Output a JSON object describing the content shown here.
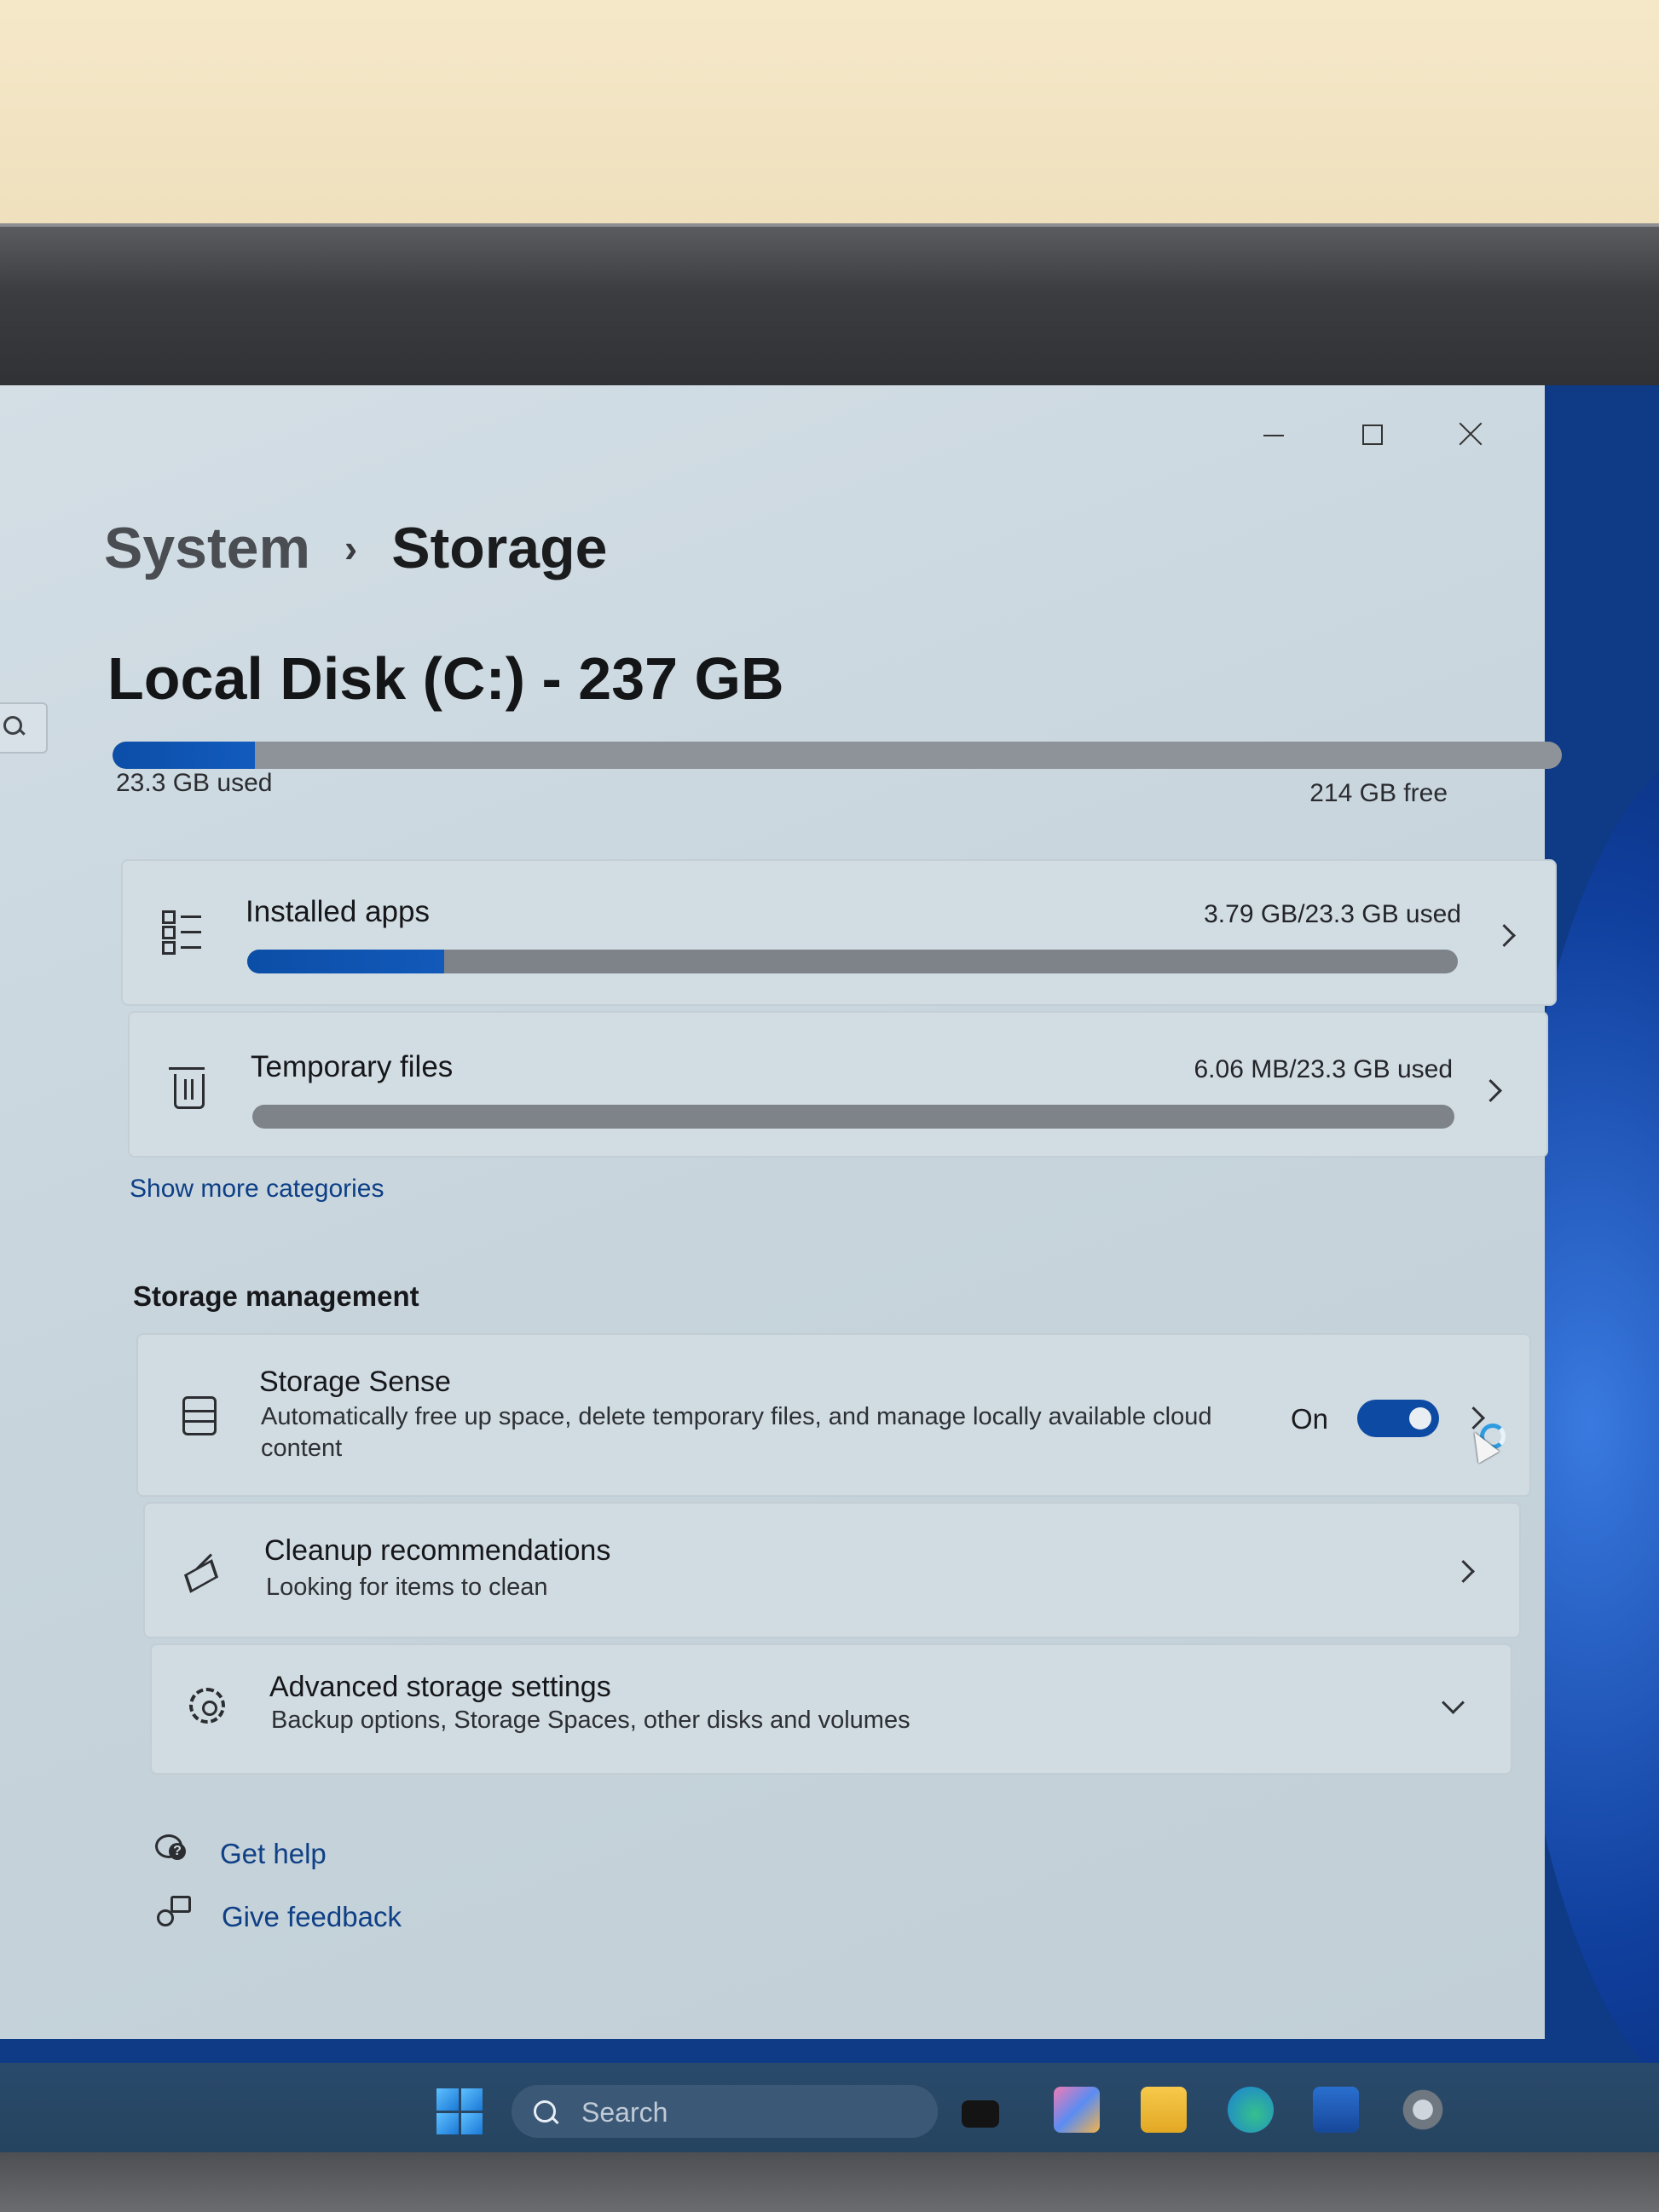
{
  "window": {
    "controls": {
      "minimize": "minimize",
      "maximize": "maximize",
      "close": "close"
    }
  },
  "breadcrumb": {
    "parent": "System",
    "separator": "›",
    "current": "Storage"
  },
  "disk": {
    "title": "Local Disk (C:) - 237 GB",
    "used_label": "23.3 GB used",
    "free_label": "214 GB free",
    "used_fraction": 0.098
  },
  "categories": [
    {
      "label": "Installed apps",
      "usage": "3.79 GB/23.3 GB used",
      "fraction": 0.163,
      "icon": "list-icon"
    },
    {
      "label": "Temporary files",
      "usage": "6.06 MB/23.3 GB used",
      "fraction": 0.0,
      "icon": "trash-icon"
    }
  ],
  "show_more": "Show more categories",
  "storage_management": {
    "heading": "Storage management",
    "items": [
      {
        "title": "Storage Sense",
        "desc": "Automatically free up space, delete temporary files, and manage locally available cloud content",
        "toggle_label": "On",
        "toggle_on": true,
        "icon": "drive-icon"
      },
      {
        "title": "Cleanup recommendations",
        "desc": "Looking for items to clean",
        "icon": "broom-icon"
      },
      {
        "title": "Advanced storage settings",
        "desc": "Backup options, Storage Spaces, other disks and volumes",
        "icon": "gear-icon"
      }
    ]
  },
  "help": {
    "get_help": "Get help",
    "give_feedback": "Give feedback"
  },
  "taskbar": {
    "search_placeholder": "Search",
    "apps": [
      "task-view-icon",
      "copilot-icon",
      "file-explorer-icon",
      "edge-icon",
      "store-icon",
      "settings-icon"
    ]
  },
  "colors": {
    "accent": "#0c4ea8",
    "link": "#0f3f85",
    "window_bg": "#c9d6dd"
  }
}
